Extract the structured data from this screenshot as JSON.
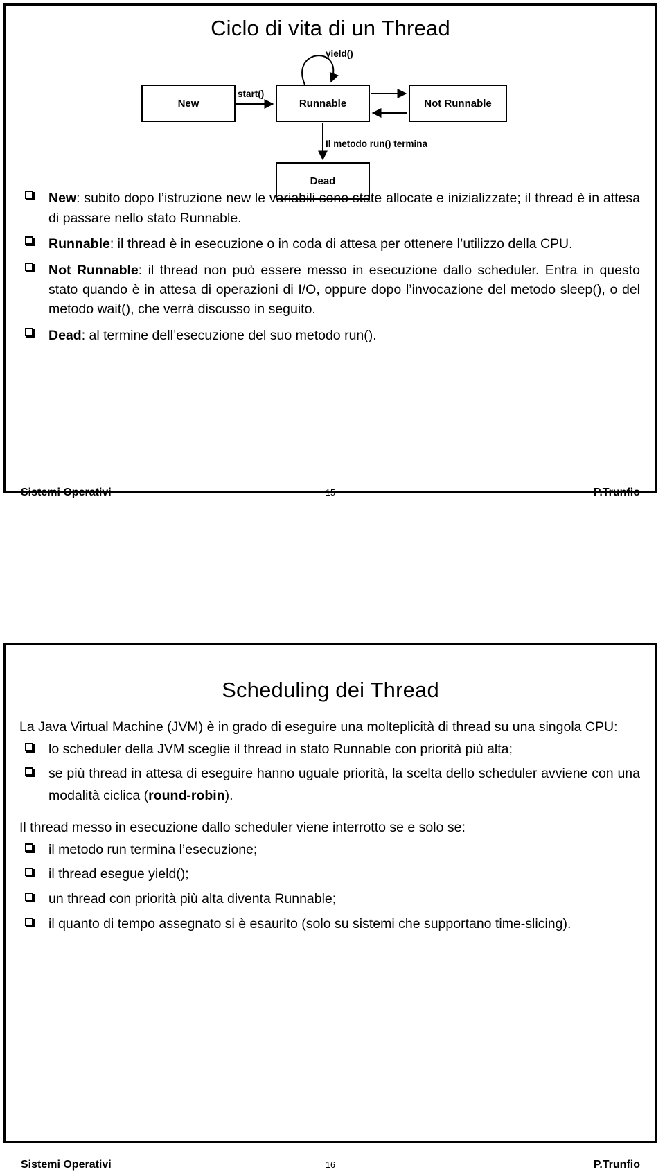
{
  "document": {
    "pages": [
      {
        "id": "slide-15",
        "title": "Ciclo di vita di un Thread",
        "diagram": {
          "type": "state-machine",
          "states": [
            {
              "id": "new",
              "label": "New"
            },
            {
              "id": "runnable",
              "label": "Runnable"
            },
            {
              "id": "not-runnable",
              "label": "Not Runnable"
            },
            {
              "id": "dead",
              "label": "Dead"
            }
          ],
          "transitions": [
            {
              "from": "new",
              "to": "runnable",
              "label": "start()"
            },
            {
              "from": "runnable",
              "to": "runnable",
              "label": "yield()"
            },
            {
              "from": "runnable",
              "to": "not-runnable",
              "label": ""
            },
            {
              "from": "not-runnable",
              "to": "runnable",
              "label": ""
            },
            {
              "from": "runnable",
              "to": "dead",
              "label": "Il metodo run() termina"
            }
          ]
        },
        "bullets": [
          {
            "term": "New",
            "rest": ": subito dopo l’istruzione new le variabili sono state allocate e inizializzate; il thread è in attesa di passare nello stato Runnable."
          },
          {
            "term": "Runnable",
            "rest": ": il thread è in esecuzione o in coda di attesa per ottenere l’utilizzo della CPU."
          },
          {
            "term": "Not Runnable",
            "rest": ": il thread non può essere messo in esecuzione dallo scheduler. Entra in questo stato quando è in attesa di operazioni di I/O, oppure dopo l’invocazione del metodo sleep(), o del metodo wait(), che verrà discusso in seguito."
          },
          {
            "term": "Dead",
            "rest": ": al termine dell’esecuzione del suo metodo run()."
          }
        ],
        "footer": {
          "left": "Sistemi Operativi",
          "center": "15",
          "right": "P.Trunfio"
        }
      },
      {
        "id": "slide-16",
        "title": "Scheduling dei Thread",
        "intro": "La Java Virtual Machine (JVM) è in grado di eseguire una molteplicità di thread su una singola CPU:",
        "bullets_a": [
          {
            "text": "lo scheduler della JVM sceglie il thread in stato Runnable con priorità più alta;"
          },
          {
            "pre": "se più thread in attesa di eseguire hanno uguale priorità, la scelta dello scheduler avviene con una modalità ciclica (",
            "strong": "round-robin",
            "post": ")."
          }
        ],
        "midtext": "Il thread messo in esecuzione dallo scheduler viene interrotto se e solo se:",
        "bullets_b": [
          {
            "text": "il metodo run termina l’esecuzione;"
          },
          {
            "text": "il thread esegue yield();"
          },
          {
            "text": "un thread con priorità più alta diventa Runnable;"
          },
          {
            "text": "il quanto di tempo assegnato si è esaurito (solo su sistemi che supportano time-slicing)."
          }
        ],
        "footer": {
          "left": "Sistemi Operativi",
          "center": "16",
          "right": "P.Trunfio"
        }
      }
    ]
  },
  "colors": {
    "ink": "#000000",
    "paper": "#ffffff"
  }
}
